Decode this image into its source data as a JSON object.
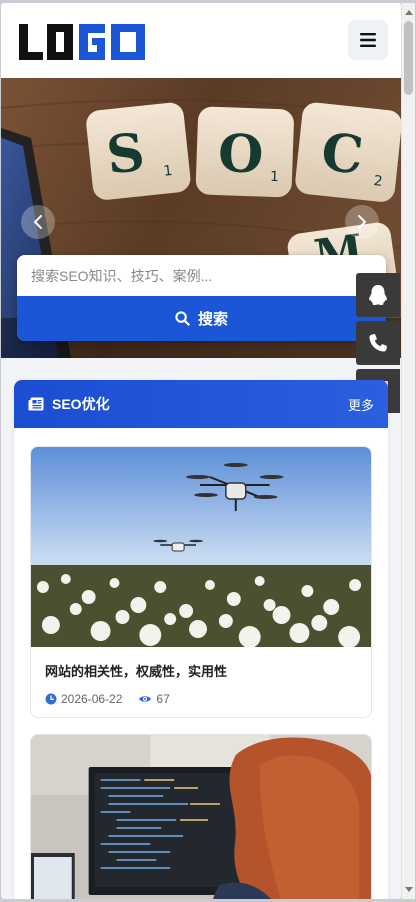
{
  "header": {
    "logo_text": "LOGO",
    "menu_icon": "hamburger-menu-icon"
  },
  "banner": {
    "tiles": [
      "S",
      "O",
      "C",
      "M"
    ],
    "tile_subscripts": [
      "1",
      "1",
      "2"
    ],
    "prev_icon": "chevron-left-icon",
    "next_icon": "chevron-right-icon"
  },
  "search": {
    "placeholder": "搜索SEO知识、技巧、案例...",
    "button_label": "搜索",
    "button_icon": "search-icon"
  },
  "side_tools": [
    {
      "icon": "qq-penguin-icon"
    },
    {
      "icon": "phone-icon"
    },
    {
      "icon": "qrcode-icon"
    }
  ],
  "section": {
    "title": "SEO优化",
    "more_label": "更多",
    "icon": "newspaper-icon"
  },
  "articles": [
    {
      "title": "网站的相关性，权威性，实用性",
      "date": "2026-06-22",
      "views": "67",
      "image": "drone-over-cotton-field"
    },
    {
      "title": "",
      "date": "",
      "views": "",
      "image": "person-at-code-monitor"
    }
  ],
  "colors": {
    "primary": "#1b56d6",
    "section_header": "#1b4dd2",
    "side_tool_bg": "#3a3a3a",
    "logo_dark": "#111111",
    "logo_blue": "#1b56d6"
  }
}
